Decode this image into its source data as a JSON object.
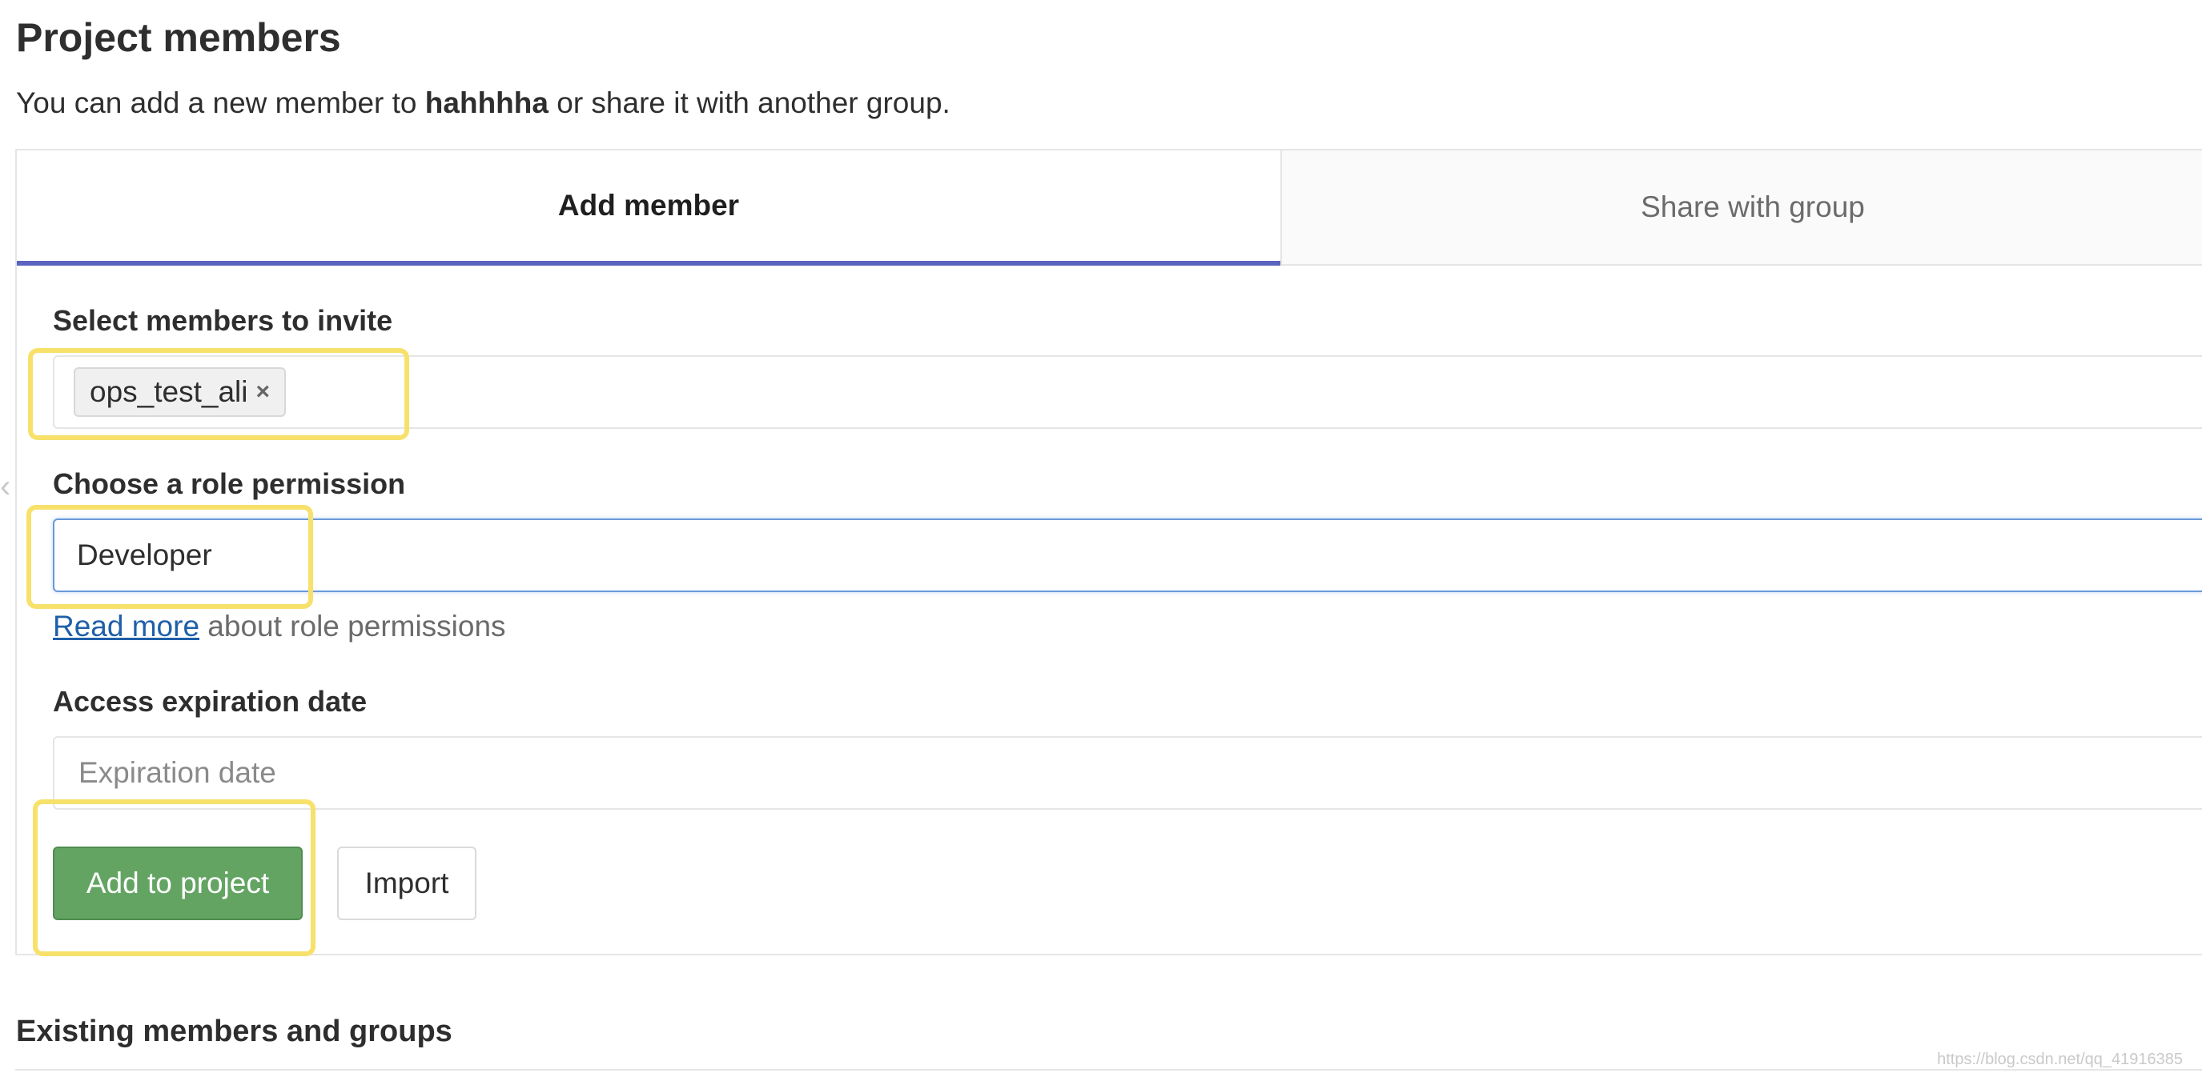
{
  "page": {
    "title": "Project members",
    "intro_prefix": "You can add a new member to ",
    "project_name": "hahhhha",
    "intro_suffix": " or share it with another group."
  },
  "tabs": [
    {
      "label": "Add member",
      "active": true
    },
    {
      "label": "Share with group",
      "active": false
    }
  ],
  "form": {
    "members_label": "Select members to invite",
    "selected_members": [
      {
        "label": "ops_test_ali",
        "remove_glyph": "×"
      }
    ],
    "role_label": "Choose a role permission",
    "role_value": "Developer",
    "role_help_link": "Read more",
    "role_help_text": " about role permissions",
    "expiration_label": "Access expiration date",
    "expiration_placeholder": "Expiration date",
    "expiration_value": ""
  },
  "buttons": {
    "add_label": "Add to project",
    "import_label": "Import"
  },
  "section": {
    "existing_title": "Existing members and groups"
  },
  "watermark": "https://blog.csdn.net/qq_41916385",
  "colors": {
    "tab_active_border": "#5b63c0",
    "primary_button": "#63a463",
    "highlight": "#f7e16b",
    "link": "#1f5fa8",
    "focus_border": "#6a9ad8"
  },
  "icons": {
    "remove_token": "close-icon"
  }
}
